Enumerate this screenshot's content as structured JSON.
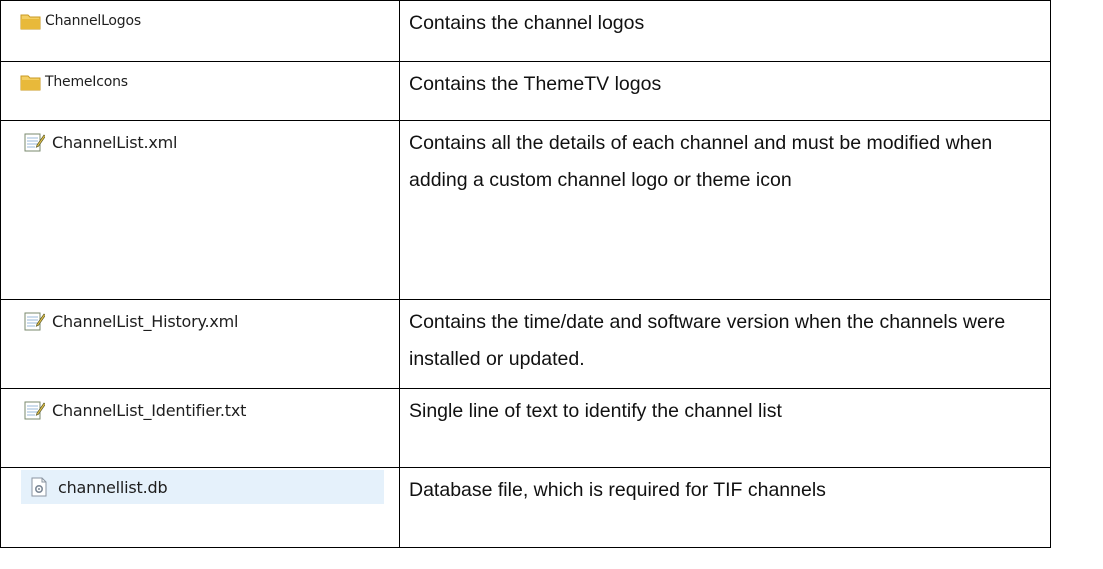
{
  "rows": [
    {
      "name": "ChannelLogos",
      "icon": "folder-icon",
      "description": "Contains the channel logos"
    },
    {
      "name": "ThemeIcons",
      "icon": "folder-icon",
      "description": "Contains the ThemeTV logos"
    },
    {
      "name": "ChannelList.xml",
      "icon": "notepad-file-icon",
      "description": "Contains all the details of each channel and must be modified when adding a custom channel logo or theme icon"
    },
    {
      "name": "ChannelList_History.xml",
      "icon": "notepad-file-icon",
      "description": "Contains the time/date and software version when the channels were installed or updated."
    },
    {
      "name": "ChannelList_Identifier.txt",
      "icon": "notepad-file-icon",
      "description": "Single line of text to identify the channel list"
    },
    {
      "name": "channellist.db",
      "icon": "settings-file-icon",
      "description": "Database file, which is required for TIF channels",
      "selected": true
    }
  ],
  "colors": {
    "border": "#000000",
    "selection": "#e5f1fb",
    "folder": "#e8b93a"
  }
}
